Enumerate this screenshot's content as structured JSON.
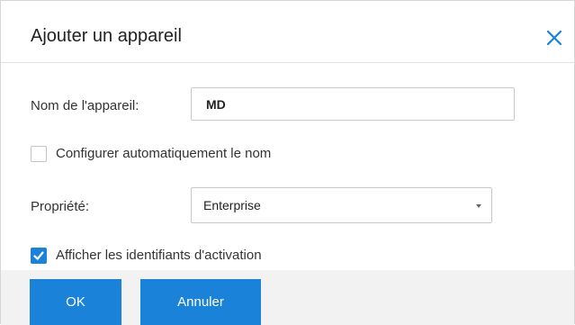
{
  "dialog": {
    "title": "Ajouter un appareil",
    "close_icon": "close-icon"
  },
  "form": {
    "device_name_label": "Nom de l'appareil:",
    "device_name_value": "MD",
    "auto_config_label": "Configurer automatiquement le nom",
    "auto_config_checked": false,
    "ownership_label": "Propriété:",
    "ownership_value": "Enterprise",
    "show_credentials_label": "Afficher les identifiants d'activation",
    "show_credentials_checked": true
  },
  "footer": {
    "ok_label": "OK",
    "cancel_label": "Annuler"
  },
  "colors": {
    "accent": "#1a82d8",
    "footer_bg": "#f2f2f2",
    "border": "#c9c9c9"
  }
}
